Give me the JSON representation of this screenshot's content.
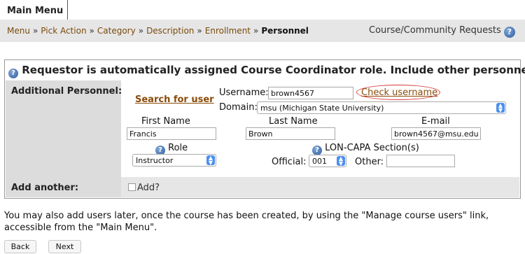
{
  "header": {
    "main_menu_tab": "Main Menu",
    "breadcrumb": [
      "Menu",
      "Pick Action",
      "Category",
      "Description",
      "Enrollment",
      "Personnel"
    ],
    "breadcrumb_sep": "»",
    "requests_link": "Course/Community Requests"
  },
  "panel": {
    "title": "Requestor is automatically assigned Course Coordinator role. Include other personnel?",
    "additional_label": "Additional Personnel:",
    "search_link": "Search for user",
    "username_label": "Username:",
    "username_value": "brown4567",
    "check_link": "Check username",
    "domain_label": "Domain:",
    "domain_value": "msu (Michigan State University)",
    "first_name_header": "First Name",
    "last_name_header": "Last Name",
    "email_header": "E-mail",
    "first_name_value": "Francis",
    "last_name_value": "Brown",
    "email_value": "brown4567@msu.edu",
    "role_header": "Role",
    "role_value": "Instructor",
    "section_header": "LON-CAPA Section(s)",
    "official_label": "Official:",
    "official_value": "001",
    "other_label": "Other:",
    "other_value": "",
    "add_another_label": "Add another:",
    "add_checkbox_label": "Add?"
  },
  "note": "You may also add users later, once the course has been created, by using the \"Manage course users\" link, accessible from the \"Main Menu\".",
  "buttons": {
    "back": "Back",
    "next": "Next"
  },
  "colors": {
    "link": "#8a4b0a",
    "highlight_ellipse": "#d63a3a",
    "help_icon": "#2f5d9e"
  },
  "icons": {
    "help": "help-icon",
    "select_arrow": "chevron-updown-icon"
  }
}
